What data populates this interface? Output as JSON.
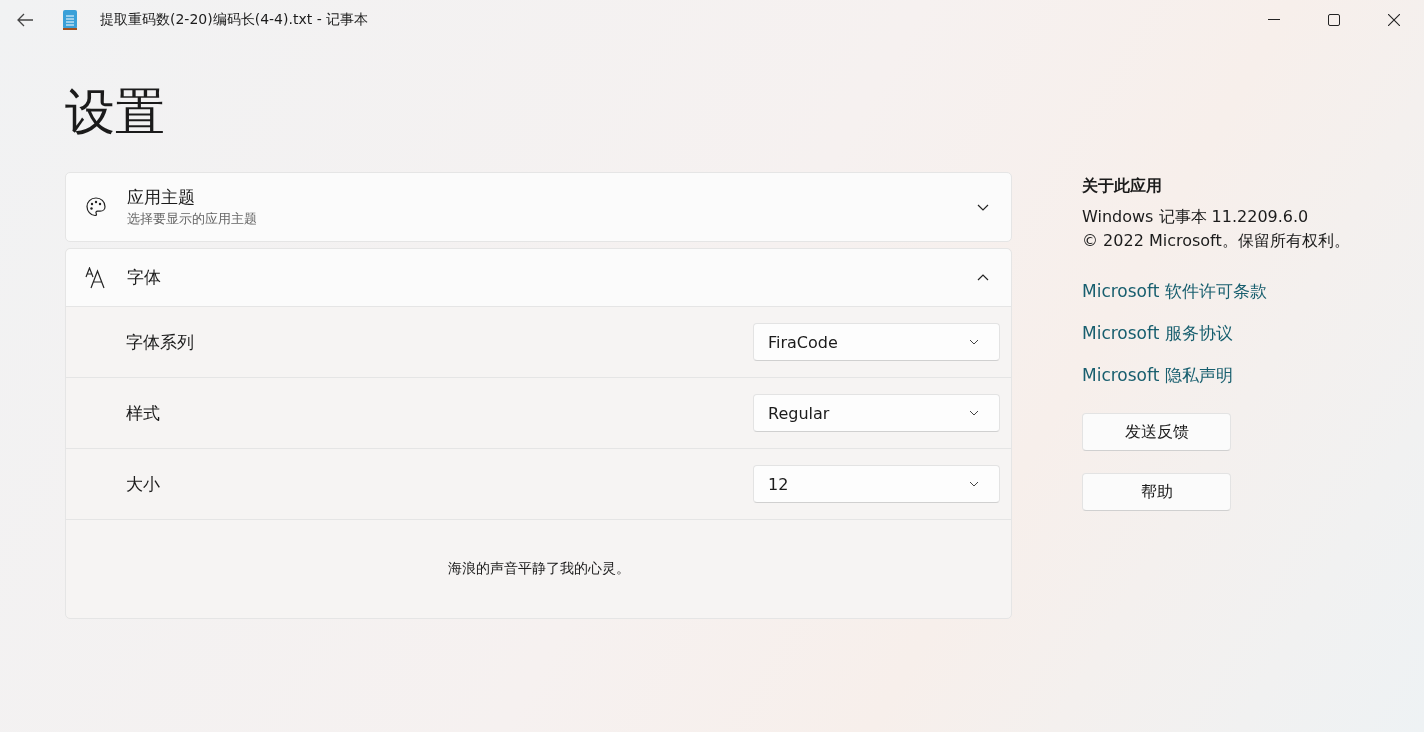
{
  "window": {
    "title": "提取重码数(2-20)编码长(4-4).txt - 记事本"
  },
  "page_title": "设置",
  "theme_section": {
    "title": "应用主题",
    "subtitle": "选择要显示的应用主题",
    "expanded": false
  },
  "font_section": {
    "title": "字体",
    "expanded": true,
    "settings": [
      {
        "label": "字体系列",
        "value": "FiraCode"
      },
      {
        "label": "样式",
        "value": "Regular"
      },
      {
        "label": "大小",
        "value": "12"
      }
    ],
    "preview": "海浪的声音平静了我的心灵。"
  },
  "about": {
    "heading": "关于此应用",
    "version": "Windows 记事本 11.2209.6.0",
    "copyright": "© 2022 Microsoft。保留所有权利。",
    "links": [
      "Microsoft 软件许可条款",
      "Microsoft 服务协议",
      "Microsoft 隐私声明"
    ],
    "buttons": [
      "发送反馈",
      "帮助"
    ]
  }
}
